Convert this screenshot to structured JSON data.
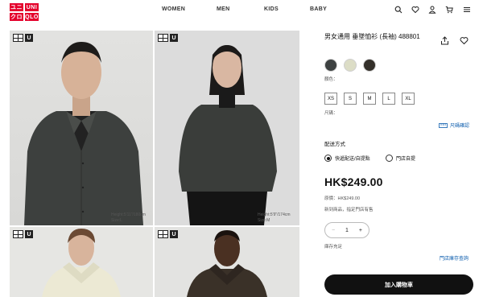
{
  "header": {
    "logo_top": [
      "ユニ",
      "UNI"
    ],
    "logo_bottom": [
      "クロ",
      "QLO"
    ],
    "nav": [
      "WOMEN",
      "MEN",
      "KIDS",
      "BABY"
    ]
  },
  "gallery": {
    "badge_u": "U",
    "captions": {
      "photo1": [
        "Height:5'11\"/180cm",
        "Size:L"
      ],
      "photo2": [
        "Height:5'9\"/174cm",
        "Size:M"
      ]
    }
  },
  "product": {
    "title": "男女通用 垂墜恤衫 (長袖) 488801",
    "colors": [
      "#3d4141",
      "#dcddc6",
      "#34302a"
    ],
    "color_label": "顏色：",
    "sizes": [
      "XS",
      "S",
      "M",
      "L",
      "XL"
    ],
    "size_label": "尺碼：",
    "size_guide": "尺碼確認",
    "delivery_title": "配送方式",
    "delivery_options": [
      "快遞配送/自提點",
      "門店自提"
    ],
    "price": "HK$249.00",
    "original_price": "原價：HK$249.00",
    "note": "新到商品，指定門店有售",
    "quantity": {
      "minus": "−",
      "value": "1",
      "plus": "+"
    },
    "stock": "庫存充足",
    "store_stock": "門店庫存查詢",
    "add_to_cart": "加入購物車"
  }
}
